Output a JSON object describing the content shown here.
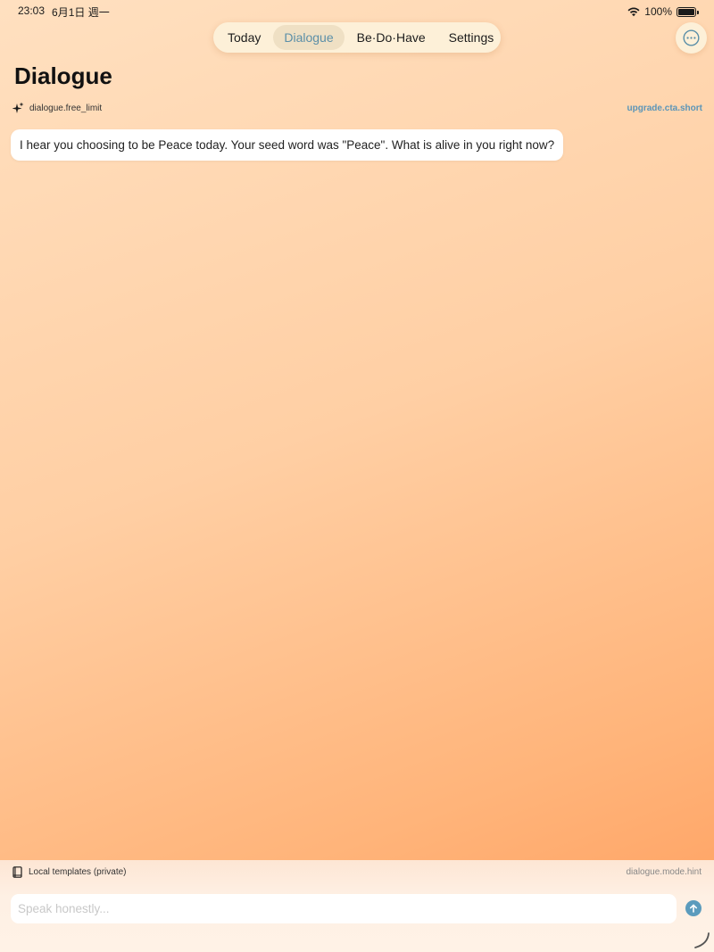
{
  "status_bar": {
    "time": "23:03",
    "date": "6月1日 週一",
    "battery_text": "100%",
    "battery_level": 1.0
  },
  "nav": {
    "tabs": [
      {
        "label": "Today",
        "active": false
      },
      {
        "label": "Dialogue",
        "active": true
      },
      {
        "label": "Be·Do·Have",
        "active": false
      },
      {
        "label": "Settings",
        "active": false
      }
    ]
  },
  "page": {
    "title": "Dialogue"
  },
  "limit_bar": {
    "label": "dialogue.free_limit",
    "upgrade_label": "upgrade.cta.short"
  },
  "messages": [
    {
      "text": "I hear you choosing to be Peace today. Your seed word was \"Peace\". What is alive in you right now?"
    }
  ],
  "footer": {
    "mode_label": "Local templates (private)",
    "mode_hint": "dialogue.mode.hint",
    "input_placeholder": "Speak honestly...",
    "input_value": ""
  },
  "icons": {
    "wifi": "wifi-icon",
    "battery": "battery-icon",
    "more": "ellipsis-circle-icon",
    "sparkles": "sparkles-icon",
    "book": "book-icon",
    "send": "arrow-up-circle-icon",
    "resize": "resize-handle-icon"
  },
  "colors": {
    "accent": "#5b9bbd",
    "active_tab_text": "#5b8fa8",
    "nav_background": "#fdf0d8",
    "link": "#5b95b8"
  }
}
